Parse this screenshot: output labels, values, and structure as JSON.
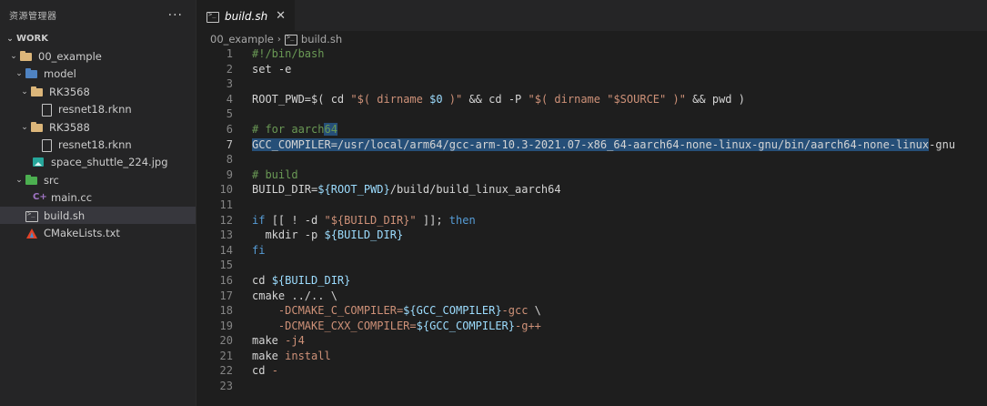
{
  "sidebar": {
    "title": "资源管理器",
    "more": "···",
    "section": "WORK",
    "items": [
      {
        "label": "00_example",
        "depth": 1
      },
      {
        "label": "model",
        "depth": 2
      },
      {
        "label": "RK3568",
        "depth": 3
      },
      {
        "label": "resnet18.rknn",
        "depth": 4
      },
      {
        "label": "RK3588",
        "depth": 3
      },
      {
        "label": "resnet18.rknn",
        "depth": 4
      },
      {
        "label": "space_shuttle_224.jpg",
        "depth": 3
      },
      {
        "label": "src",
        "depth": 2
      },
      {
        "label": "main.cc",
        "depth": 3
      },
      {
        "label": "build.sh",
        "depth": 2
      },
      {
        "label": "CMakeLists.txt",
        "depth": 2
      }
    ]
  },
  "tab": {
    "label": "build.sh",
    "close": "✕"
  },
  "breadcrumb": {
    "folder": "00_example",
    "file": "build.sh"
  },
  "code": {
    "line_numbers": [
      "1",
      "2",
      "3",
      "4",
      "5",
      "6",
      "7",
      "8",
      "9",
      "10",
      "11",
      "12",
      "13",
      "14",
      "15",
      "16",
      "17",
      "18",
      "19",
      "20",
      "21",
      "22",
      "23"
    ],
    "active_line": "7",
    "lines": [
      [
        {
          "t": "#!/bin/bash",
          "c": "c-comment"
        }
      ],
      [
        {
          "t": "set -e",
          "c": ""
        }
      ],
      [],
      [
        {
          "t": "ROOT_PWD",
          "c": ""
        },
        {
          "t": "=$( ",
          "c": ""
        },
        {
          "t": "cd ",
          "c": ""
        },
        {
          "t": "\"$( dirname ",
          "c": "c-str"
        },
        {
          "t": "$0",
          "c": "c-var"
        },
        {
          "t": " )\"",
          "c": "c-str"
        },
        {
          "t": " && ",
          "c": ""
        },
        {
          "t": "cd ",
          "c": ""
        },
        {
          "t": "-P ",
          "c": ""
        },
        {
          "t": "\"$( dirname ",
          "c": "c-str"
        },
        {
          "t": "\"$SOURCE\"",
          "c": "c-str"
        },
        {
          "t": " )\"",
          "c": "c-str"
        },
        {
          "t": " && ",
          "c": ""
        },
        {
          "t": "pwd ",
          "c": ""
        },
        {
          "t": ")",
          "c": ""
        }
      ],
      [],
      [
        {
          "t": "# for aarch",
          "c": "c-comment"
        },
        {
          "t": "64",
          "c": "c-comment sel"
        }
      ],
      [
        {
          "t": "GCC_COMPILER=/usr/local/arm64/gcc-arm-10.3-2021.07-x86_64-aarch64-none-linux-gnu/bin/aarch64-none-linux",
          "c": "sel"
        },
        {
          "t": "-gnu",
          "c": ""
        }
      ],
      [],
      [
        {
          "t": "# build",
          "c": "c-comment"
        }
      ],
      [
        {
          "t": "BUILD_DIR",
          "c": ""
        },
        {
          "t": "=",
          "c": ""
        },
        {
          "t": "${ROOT_PWD}",
          "c": "c-var"
        },
        {
          "t": "/build/build_linux_aarch64",
          "c": ""
        }
      ],
      [],
      [
        {
          "t": "if ",
          "c": "c-kw"
        },
        {
          "t": "[[ ! -d ",
          "c": ""
        },
        {
          "t": "\"${BUILD_DIR}\"",
          "c": "c-str"
        },
        {
          "t": " ]]; ",
          "c": ""
        },
        {
          "t": "then",
          "c": "c-kw"
        }
      ],
      [
        {
          "t": "  mkdir ",
          "c": ""
        },
        {
          "t": "-p ",
          "c": ""
        },
        {
          "t": "${BUILD_DIR}",
          "c": "c-var"
        }
      ],
      [
        {
          "t": "fi",
          "c": "c-kw"
        }
      ],
      [],
      [
        {
          "t": "cd ",
          "c": ""
        },
        {
          "t": "${BUILD_DIR}",
          "c": "c-var"
        }
      ],
      [
        {
          "t": "cmake ",
          "c": ""
        },
        {
          "t": "../.. \\",
          "c": ""
        }
      ],
      [
        {
          "t": "    -DCMAKE_C_COMPILER=",
          "c": "c-str"
        },
        {
          "t": "${GCC_COMPILER}",
          "c": "c-var"
        },
        {
          "t": "-gcc",
          "c": "c-str"
        },
        {
          "t": " \\",
          "c": ""
        }
      ],
      [
        {
          "t": "    -DCMAKE_CXX_COMPILER=",
          "c": "c-str"
        },
        {
          "t": "${GCC_COMPILER}",
          "c": "c-var"
        },
        {
          "t": "-g++",
          "c": "c-str"
        }
      ],
      [
        {
          "t": "make ",
          "c": ""
        },
        {
          "t": "-j4",
          "c": "c-str"
        }
      ],
      [
        {
          "t": "make ",
          "c": ""
        },
        {
          "t": "install",
          "c": "c-str"
        }
      ],
      [
        {
          "t": "cd ",
          "c": ""
        },
        {
          "t": "-",
          "c": "c-str"
        }
      ],
      []
    ]
  },
  "colors": {
    "background": "#1e1e1e",
    "sidebar": "#252526",
    "selection": "#264f78",
    "selected_row": "#37373d"
  }
}
